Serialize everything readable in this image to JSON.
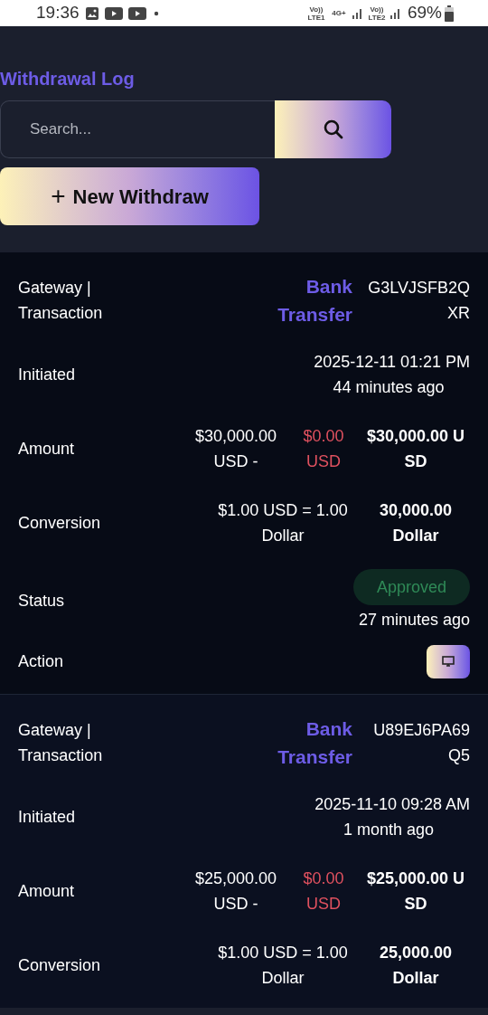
{
  "status_bar": {
    "time": "19:36",
    "network": [
      "Vo)) LTE1",
      "4G+",
      "Vo)) LTE2"
    ],
    "battery": "69%"
  },
  "title": "Withdrawal Log",
  "search": {
    "placeholder": "Search..."
  },
  "new_button": {
    "icon": "+",
    "label": "New Withdraw"
  },
  "records": [
    {
      "rows": [
        {
          "kind": "gateway",
          "label": "Gateway | Transaction",
          "gateway": "Bank Transfer",
          "transaction": "G3LVJSFB2QXR"
        },
        {
          "kind": "initiated",
          "label": "Initiated",
          "date": "2025-12-11 01:21 PM",
          "ago": "44 minutes ago"
        },
        {
          "kind": "amount",
          "label": "Amount",
          "amount": "$30,000.00 USD -",
          "charge": "$0.00 USD",
          "total": "$30,000.00 USD"
        },
        {
          "kind": "conversion",
          "label": "Conversion",
          "rate": "$1.00 USD = 1.00 Dollar",
          "result": "30,000.00 Dollar"
        },
        {
          "kind": "status",
          "label": "Status",
          "badge": "Approved",
          "ago": "27 minutes ago"
        },
        {
          "kind": "action",
          "label": "Action"
        }
      ]
    },
    {
      "rows": [
        {
          "kind": "gateway",
          "label": "Gateway | Transaction",
          "gateway": "Bank Transfer",
          "transaction": "U89EJ6PA69Q5"
        },
        {
          "kind": "initiated",
          "label": "Initiated",
          "date": "2025-11-10 09:28 AM",
          "ago": "1 month ago"
        },
        {
          "kind": "amount",
          "label": "Amount",
          "amount": "$25,000.00 USD -",
          "charge": "$0.00 USD",
          "total": "$25,000.00 USD"
        },
        {
          "kind": "conversion",
          "label": "Conversion",
          "rate": "$1.00 USD = 1.00 Dollar",
          "result": "25,000.00 Dollar"
        }
      ]
    }
  ]
}
